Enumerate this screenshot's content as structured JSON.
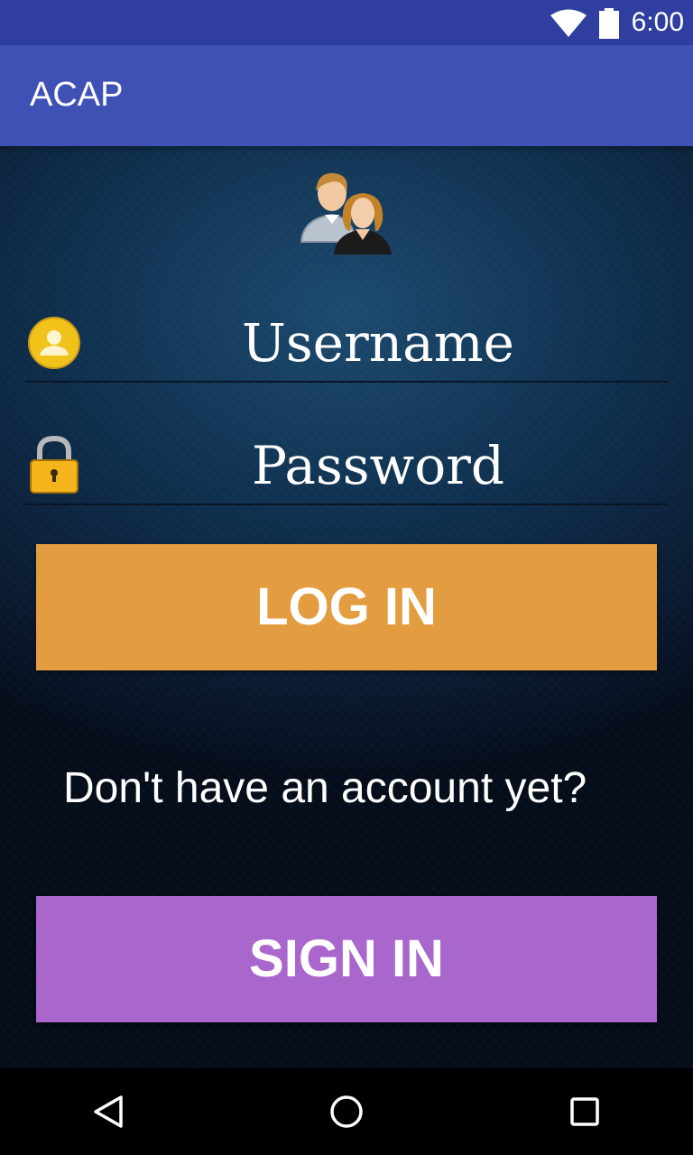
{
  "status_bar": {
    "time": "6:00",
    "wifi_icon": "wifi-icon",
    "battery_icon": "battery-icon"
  },
  "app_bar": {
    "title": "ACAP"
  },
  "login": {
    "header_icon": "users-icon",
    "username": {
      "placeholder": "Username",
      "icon": "user-avatar-icon"
    },
    "password": {
      "placeholder": "Password",
      "icon": "lock-icon"
    },
    "login_label": "LOG IN",
    "prompt": "Don't have an account yet?",
    "signin_label": "SIGN IN"
  },
  "colors": {
    "status_bar": "#303F9F",
    "app_bar": "#3F51B5",
    "login_button": "#E39D40",
    "signin_button": "#A966CC"
  },
  "nav_bar": {
    "back_icon": "back-icon",
    "home_icon": "home-icon",
    "recents_icon": "recents-icon"
  }
}
